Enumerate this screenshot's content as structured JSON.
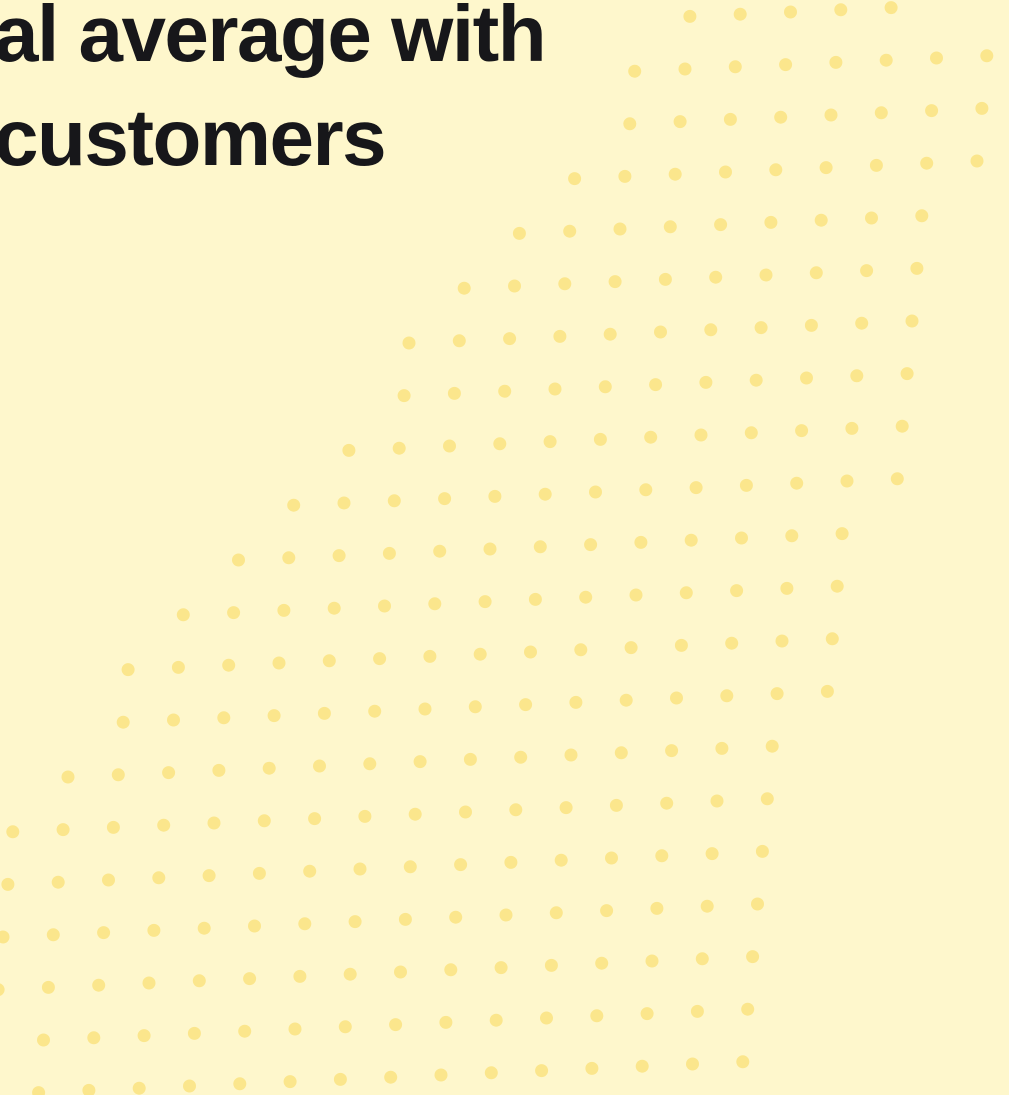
{
  "headline": {
    "line1": "al average with",
    "line2": "customers"
  },
  "colors": {
    "background": "#FEF7CC",
    "text": "#17171A",
    "dots": "#FBE68C"
  },
  "decoration": {
    "dot_pattern_icon": "halftone-dot-wave-icon"
  }
}
